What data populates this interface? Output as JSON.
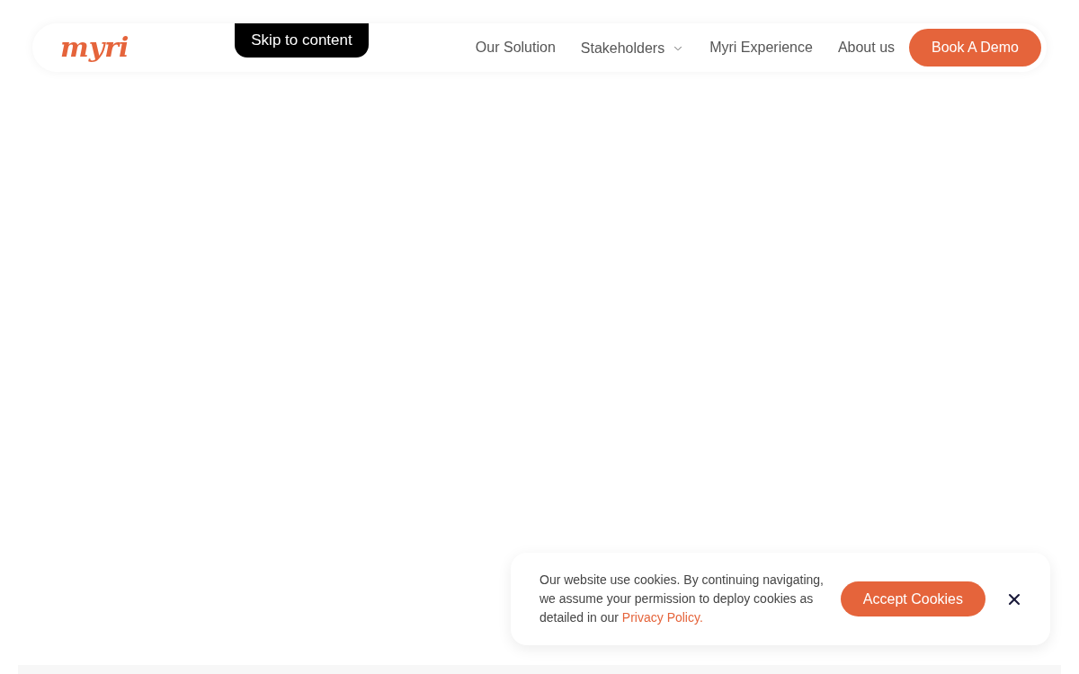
{
  "skip_link": "Skip to content",
  "header": {
    "logo": "myri",
    "nav": [
      {
        "label": "Our Solution",
        "kind": "link"
      },
      {
        "label": "Stakeholders",
        "kind": "dropdown"
      },
      {
        "label": "Myri Experience",
        "kind": "link"
      },
      {
        "label": "About us",
        "kind": "link"
      }
    ],
    "cta": "Book A Demo"
  },
  "cookie_banner": {
    "text": "Our website use cookies. By continuing navigating, we assume your permission to deploy cookies as detailed in our",
    "link": "Privacy Policy.",
    "accept": "Accept Cookies"
  }
}
